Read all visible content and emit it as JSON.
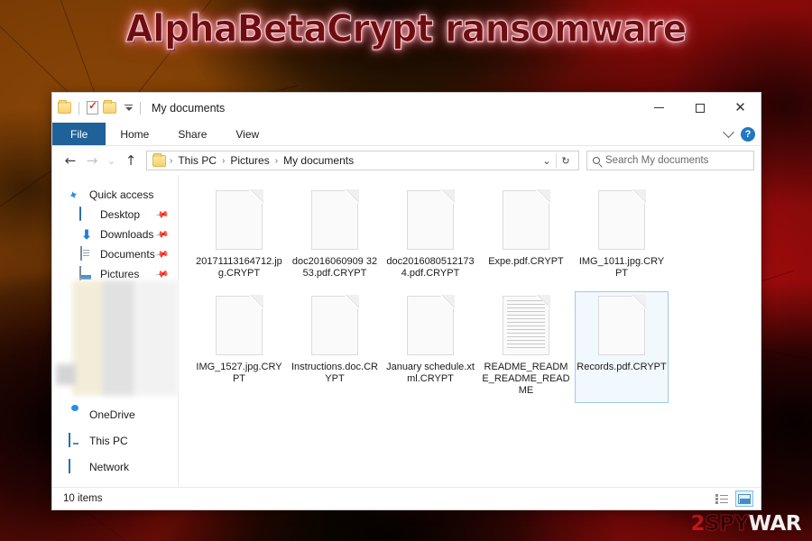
{
  "headline": {
    "text": "AlphaBetaCrypt ransomware",
    "fill_color": "#6e0d10",
    "glow_color": "#ffd9de"
  },
  "window": {
    "title": "My documents",
    "quick_access_toolbar": [
      {
        "name": "folder-icon",
        "label": ""
      },
      {
        "name": "properties-icon",
        "label": ""
      },
      {
        "name": "new-folder-icon",
        "label": ""
      },
      {
        "name": "customize-qat-caret",
        "label": ""
      }
    ],
    "controls": {
      "minimize": "–",
      "maximize": "□",
      "close": "✕"
    },
    "ribbon_collapse_icon": "chevron-down-icon",
    "help_label": "?"
  },
  "ribbon": {
    "tabs": [
      {
        "label": "File",
        "active": true
      },
      {
        "label": "Home",
        "active": false
      },
      {
        "label": "Share",
        "active": false
      },
      {
        "label": "View",
        "active": false
      }
    ],
    "file_tab_color": "#1f6199"
  },
  "address_bar": {
    "back_label": "←",
    "forward_label": "→",
    "recent_label": "⌄",
    "up_label": "↑",
    "breadcrumbs": [
      "This PC",
      "Pictures",
      "My documents"
    ],
    "separator": "›",
    "history_caret": "⌄",
    "refresh_label": "↻"
  },
  "search": {
    "placeholder": "Search My documents",
    "icon": "search-icon"
  },
  "nav_pane": {
    "items": [
      {
        "label": "Quick access",
        "icon": "star-icon",
        "pinned": false,
        "level": 1
      },
      {
        "label": "Desktop",
        "icon": "desktop-icon",
        "pinned": true,
        "level": 2
      },
      {
        "label": "Downloads",
        "icon": "download-icon",
        "pinned": true,
        "level": 2
      },
      {
        "label": "Documents",
        "icon": "documents-icon",
        "pinned": true,
        "level": 2
      },
      {
        "label": "Pictures",
        "icon": "pictures-icon",
        "pinned": true,
        "level": 2
      }
    ],
    "items_bottom": [
      {
        "label": "OneDrive",
        "icon": "onedrive-icon",
        "level": 1
      },
      {
        "label": "This PC",
        "icon": "this-pc-icon",
        "level": 1
      },
      {
        "label": "Network",
        "icon": "network-icon",
        "level": 1
      }
    ],
    "pin_glyph": "📌"
  },
  "files": [
    {
      "name": "20171113164712.jpg.CRYPT",
      "icon": "blank-page-icon",
      "selected": false
    },
    {
      "name": "doc2016060909 3253.pdf.CRYPT",
      "icon": "blank-page-icon",
      "selected": false
    },
    {
      "name": "doc20160805121734.pdf.CRYPT",
      "icon": "blank-page-icon",
      "selected": false
    },
    {
      "name": "Expe.pdf.CRYPT",
      "icon": "blank-page-icon",
      "selected": false
    },
    {
      "name": "IMG_1011.jpg.CRYPT",
      "icon": "blank-page-icon",
      "selected": false
    },
    {
      "name": "IMG_1527.jpg.CRYPT",
      "icon": "blank-page-icon",
      "selected": false
    },
    {
      "name": "Instructions.doc.CRYPT",
      "icon": "blank-page-icon",
      "selected": false
    },
    {
      "name": "January schedule.xtml.CRYPT",
      "icon": "blank-page-icon",
      "selected": false
    },
    {
      "name": "README_README_README_README",
      "icon": "text-page-icon",
      "selected": false
    },
    {
      "name": "Records.pdf.CRYPT",
      "icon": "blank-page-icon",
      "selected": true
    }
  ],
  "status_bar": {
    "item_count": "10 items",
    "views": [
      {
        "name": "details-view-button",
        "active": false
      },
      {
        "name": "large-icons-view-button",
        "active": true
      }
    ]
  },
  "watermark": {
    "part1": "2",
    "part2": "SPY",
    "part3": "WAR"
  }
}
